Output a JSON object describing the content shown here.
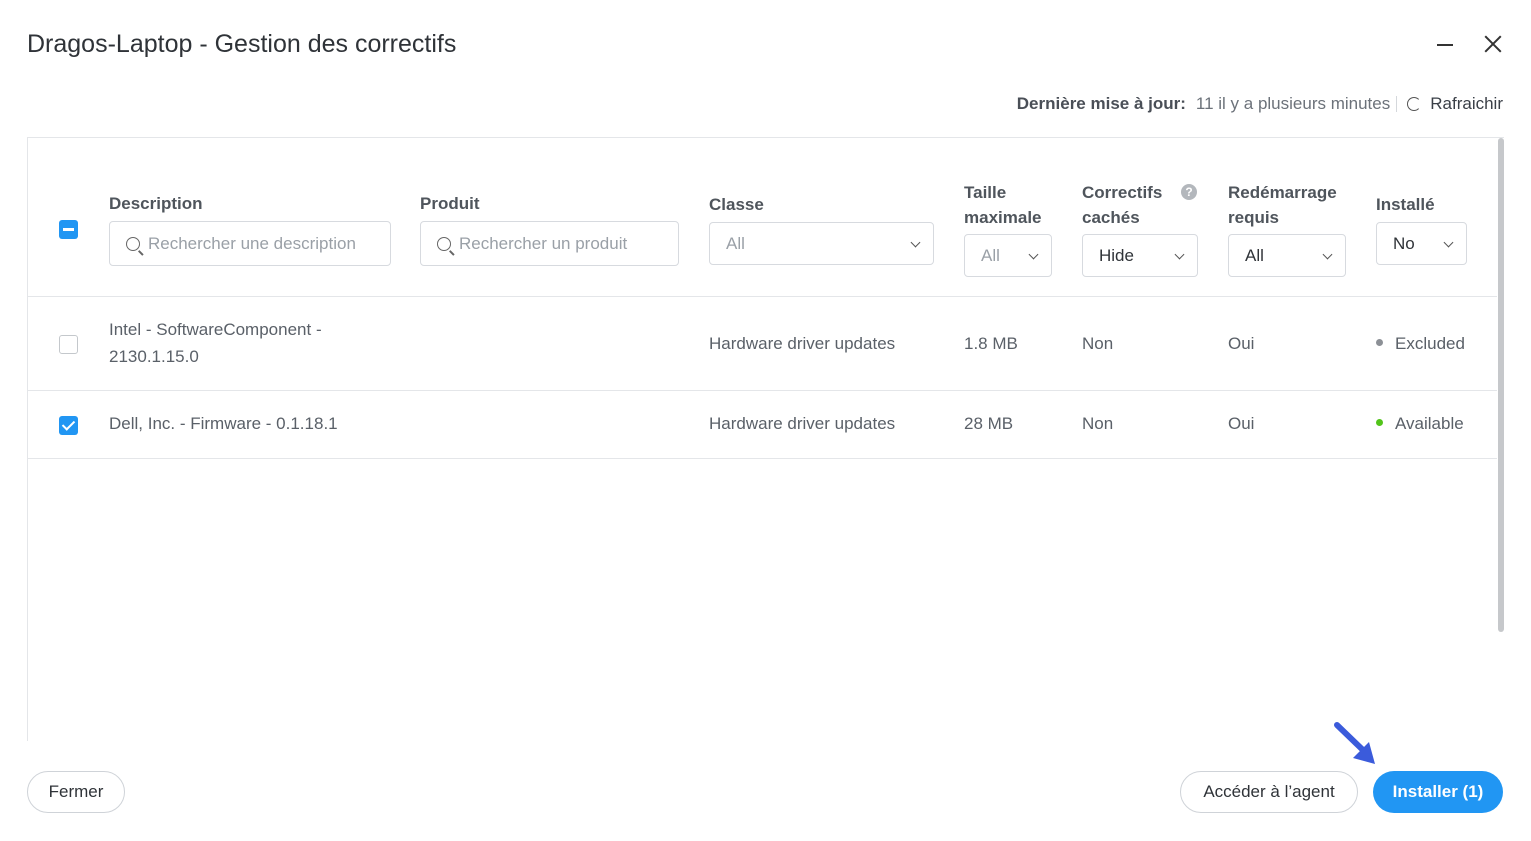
{
  "window": {
    "title": "Dragos-Laptop - Gestion des correctifs"
  },
  "update": {
    "label": "Dernière mise à jour:",
    "value": "11 il y a plusieurs minutes",
    "refresh_label": "Rafraichir"
  },
  "columns": {
    "description": {
      "label": "Description",
      "placeholder": "Rechercher une description"
    },
    "product": {
      "label": "Produit",
      "placeholder": "Rechercher un produit"
    },
    "class": {
      "label": "Classe",
      "value": "All"
    },
    "max_size": {
      "label_line1": "Taille",
      "label_line2": "maximale",
      "value": "All"
    },
    "hidden": {
      "label_line1": "Correctifs",
      "label_line2": "cachés",
      "value": "Hide"
    },
    "reboot": {
      "label_line1": "Redémarrage",
      "label_line2": "requis",
      "value": "All"
    },
    "installed": {
      "label": "Installé",
      "value": "No"
    }
  },
  "rows": [
    {
      "description_line1": "Intel - SoftwareComponent -",
      "description_line2": "2130.1.15.0",
      "class": "Hardware driver updates",
      "size": "1.8 MB",
      "hidden": "Non",
      "reboot": "Oui",
      "status": "Excluded",
      "status_color": "#8c9096",
      "checked": false
    },
    {
      "description_line1": "Dell, Inc. - Firmware - 0.1.18.1",
      "class": "Hardware driver updates",
      "size": "28 MB",
      "hidden": "Non",
      "reboot": "Oui",
      "status": "Available",
      "status_color": "#52c41a",
      "checked": true
    }
  ],
  "footer": {
    "close_label": "Fermer",
    "agent_label": "Accéder à l’agent",
    "install_label": "Installer (1)"
  },
  "colors": {
    "accent": "#2196f3",
    "arrow": "#3b5bdb"
  }
}
